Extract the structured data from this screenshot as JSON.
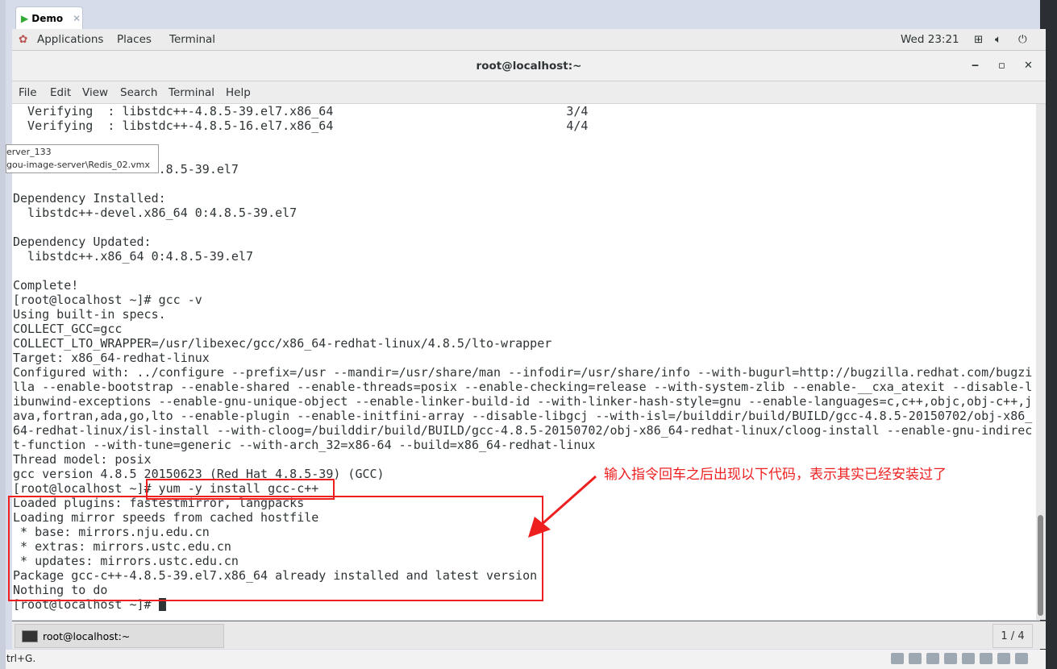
{
  "vm_tab": {
    "label": "Demo",
    "close": "✕"
  },
  "gnome": {
    "applications": "Applications",
    "places": "Places",
    "terminal": "Terminal",
    "clock": "Wed 23:21"
  },
  "window": {
    "title": "root@localhost:~",
    "minimize": "‒",
    "maximize": "▫",
    "close": "✕"
  },
  "menu": [
    "File",
    "Edit",
    "View",
    "Search",
    "Terminal",
    "Help"
  ],
  "terminal_lines": [
    "  Verifying  : libstdc++-4.8.5-39.el7.x86_64                                3/4",
    "  Verifying  : libstdc++-4.8.5-16.el7.x86_64                                4/4",
    "",
    "",
    "                    .8.5-39.el7",
    "",
    "Dependency Installed:",
    "  libstdc++-devel.x86_64 0:4.8.5-39.el7",
    "",
    "Dependency Updated:",
    "  libstdc++.x86_64 0:4.8.5-39.el7",
    "",
    "Complete!",
    "[root@localhost ~]# gcc -v",
    "Using built-in specs.",
    "COLLECT_GCC=gcc",
    "COLLECT_LTO_WRAPPER=/usr/libexec/gcc/x86_64-redhat-linux/4.8.5/lto-wrapper",
    "Target: x86_64-redhat-linux",
    "Configured with: ../configure --prefix=/usr --mandir=/usr/share/man --infodir=/usr/share/info --with-bugurl=http://bugzilla.redhat.com/bugzi",
    "lla --enable-bootstrap --enable-shared --enable-threads=posix --enable-checking=release --with-system-zlib --enable-__cxa_atexit --disable-l",
    "ibunwind-exceptions --enable-gnu-unique-object --enable-linker-build-id --with-linker-hash-style=gnu --enable-languages=c,c++,objc,obj-c++,j",
    "ava,fortran,ada,go,lto --enable-plugin --enable-initfini-array --disable-libgcj --with-isl=/builddir/build/BUILD/gcc-4.8.5-20150702/obj-x86_",
    "64-redhat-linux/isl-install --with-cloog=/builddir/build/BUILD/gcc-4.8.5-20150702/obj-x86_64-redhat-linux/cloog-install --enable-gnu-indirec",
    "t-function --with-tune=generic --with-arch_32=x86-64 --build=x86_64-redhat-linux",
    "Thread model: posix",
    "gcc version 4.8.5 20150623 (Red Hat 4.8.5-39) (GCC)",
    "[root@localhost ~]# yum -y install gcc-c++",
    "Loaded plugins: fastestmirror, langpacks",
    "Loading mirror speeds from cached hostfile",
    " * base: mirrors.nju.edu.cn",
    " * extras: mirrors.ustc.edu.cn",
    " * updates: mirrors.ustc.edu.cn",
    "Package gcc-c++-4.8.5-39.el7.x86_64 already installed and latest version",
    "Nothing to do",
    "[root@localhost ~]# "
  ],
  "tooltip": {
    "line1": "erver_133",
    "line2": "gou-image-server\\Redis_02.vmx"
  },
  "annotation": {
    "text": "输入指令回车之后出现以下代码，表示其实已经安装过了",
    "color": "#ee1f1f"
  },
  "taskbar": {
    "item": "root@localhost:~",
    "pager": "1 / 4"
  },
  "status_text": "trl+G."
}
